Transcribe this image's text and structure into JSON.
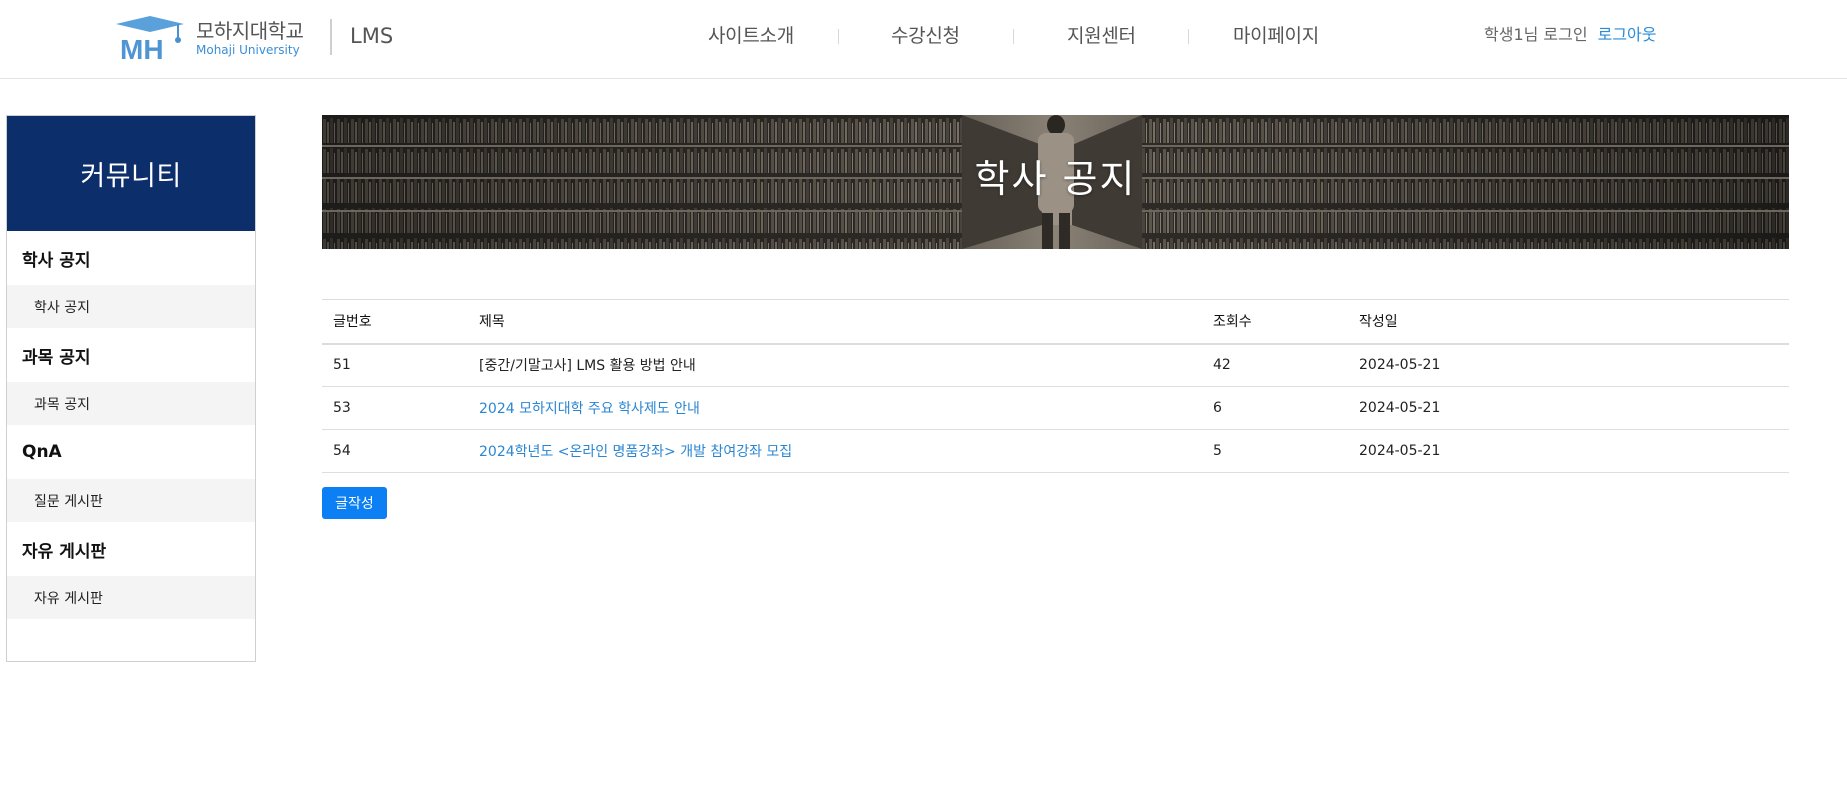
{
  "header": {
    "logo_kr": "모하지대학교",
    "logo_en": "Mohaji University",
    "logo_mark": "MH",
    "lms": "LMS",
    "nav": [
      "사이트소개",
      "수강신청",
      "지원센터",
      "마이페이지"
    ],
    "user_text": "학생1님 로그인",
    "logout": "로그아웃"
  },
  "sidebar": {
    "title": "커뮤니티",
    "groups": [
      {
        "label": "학사 공지",
        "sub": "학사 공지"
      },
      {
        "label": "과목 공지",
        "sub": "과목 공지"
      },
      {
        "label": "QnA",
        "sub": "질문 게시판"
      },
      {
        "label": "자유 게시판",
        "sub": "자유 게시판"
      }
    ]
  },
  "banner": {
    "title": "학사 공지"
  },
  "table": {
    "headers": [
      "글번호",
      "제목",
      "조회수",
      "작성일"
    ],
    "rows": [
      {
        "num": "51",
        "title": "[중간/기말고사] LMS 활용 방법 안내",
        "views": "42",
        "date": "2024-05-21"
      },
      {
        "num": "53",
        "title": "2024 모하지대학 주요 학사제도 안내",
        "views": "6",
        "date": "2024-05-21"
      },
      {
        "num": "54",
        "title": "2024학년도 <온라인 명품강좌> 개발 참여강좌 모집",
        "views": "5",
        "date": "2024-05-21"
      }
    ]
  },
  "write_button": "글작성",
  "colors": {
    "brand_navy": "#0c2e6b",
    "link_blue": "#2a86d3",
    "button_blue": "#0d7ff5",
    "logo_blue": "#3a8ed6"
  }
}
